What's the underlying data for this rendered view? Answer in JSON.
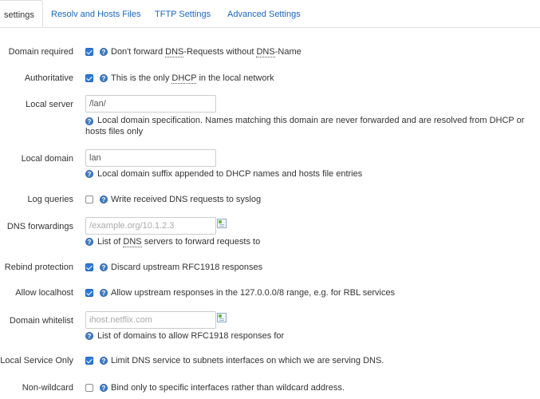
{
  "tabs": [
    {
      "label": "settings",
      "active": true
    },
    {
      "label": "Resolv and Hosts Files",
      "active": false
    },
    {
      "label": "TFTP Settings",
      "active": false
    },
    {
      "label": "Advanced Settings",
      "active": false
    }
  ],
  "help_glyph": "?",
  "fields": {
    "domain_required": {
      "label": "Domain required",
      "checked": true,
      "desc_pre": "Don't forward ",
      "desc_abbr1": "DNS",
      "desc_mid": "-Requests without ",
      "desc_abbr2": "DNS",
      "desc_post": "-Name"
    },
    "authoritative": {
      "label": "Authoritative",
      "checked": true,
      "desc_pre": "This is the only ",
      "desc_abbr": "DHCP",
      "desc_post": " in the local network"
    },
    "local_server": {
      "label": "Local server",
      "value": "/lan/",
      "desc": "Local domain specification. Names matching this domain are never forwarded and are resolved from DHCP or hosts files only"
    },
    "local_domain": {
      "label": "Local domain",
      "value": "lan",
      "desc": "Local domain suffix appended to DHCP names and hosts file entries"
    },
    "log_queries": {
      "label": "Log queries",
      "checked": false,
      "desc": "Write received DNS requests to syslog"
    },
    "dns_forwardings": {
      "label": "DNS forwardings",
      "placeholder": "/example.org/10.1.2.3",
      "desc_pre": "List of ",
      "desc_abbr": "DNS",
      "desc_post": " servers to forward requests to"
    },
    "rebind_protection": {
      "label": "Rebind protection",
      "checked": true,
      "desc": "Discard upstream RFC1918 responses"
    },
    "allow_localhost": {
      "label": "Allow localhost",
      "checked": true,
      "desc": "Allow upstream responses in the 127.0.0.0/8 range, e.g. for RBL services"
    },
    "domain_whitelist": {
      "label": "Domain whitelist",
      "placeholder": "ihost.netflix.com",
      "desc": "List of domains to allow RFC1918 responses for"
    },
    "local_service_only": {
      "label": "Local Service Only",
      "checked": true,
      "desc": "Limit DNS service to subnets interfaces on which we are serving DNS."
    },
    "non_wildcard": {
      "label": "Non-wildcard",
      "checked": false,
      "desc": "Bind only to specific interfaces rather than wildcard address."
    }
  },
  "colors": {
    "link": "#1b66c9",
    "checkbox": "#2a7ae2",
    "help": "#3f7dc6",
    "border": "#dddddd"
  }
}
